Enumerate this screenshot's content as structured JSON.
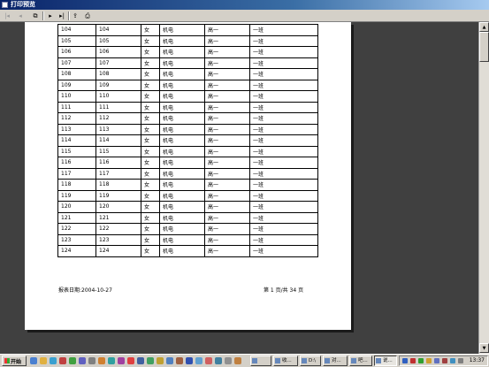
{
  "window": {
    "title": "打印预览"
  },
  "toolbar": {
    "buttons": [
      {
        "name": "first-page-icon",
        "glyph": "|◂"
      },
      {
        "name": "prev-page-icon",
        "glyph": "◂"
      },
      {
        "name": "copy-icon",
        "glyph": "⧉"
      },
      {
        "name": "next-page-icon",
        "glyph": "▸"
      },
      {
        "name": "last-page-icon",
        "glyph": "▸|"
      },
      {
        "name": "export-icon",
        "glyph": "⇪"
      },
      {
        "name": "print-icon",
        "glyph": "⎙"
      }
    ]
  },
  "report": {
    "rows": [
      [
        "104",
        "104",
        "女",
        "机电",
        "高一",
        "一班"
      ],
      [
        "105",
        "105",
        "女",
        "机电",
        "高一",
        "一班"
      ],
      [
        "106",
        "106",
        "女",
        "机电",
        "高一",
        "一班"
      ],
      [
        "107",
        "107",
        "女",
        "机电",
        "高一",
        "一班"
      ],
      [
        "108",
        "108",
        "女",
        "机电",
        "高一",
        "一班"
      ],
      [
        "109",
        "109",
        "女",
        "机电",
        "高一",
        "一班"
      ],
      [
        "110",
        "110",
        "女",
        "机电",
        "高一",
        "一班"
      ],
      [
        "111",
        "111",
        "女",
        "机电",
        "高一",
        "一班"
      ],
      [
        "112",
        "112",
        "女",
        "机电",
        "高一",
        "一班"
      ],
      [
        "113",
        "113",
        "女",
        "机电",
        "高一",
        "一班"
      ],
      [
        "114",
        "114",
        "女",
        "机电",
        "高一",
        "一班"
      ],
      [
        "115",
        "115",
        "女",
        "机电",
        "高一",
        "一班"
      ],
      [
        "116",
        "116",
        "女",
        "机电",
        "高一",
        "一班"
      ],
      [
        "117",
        "117",
        "女",
        "机电",
        "高一",
        "一班"
      ],
      [
        "118",
        "118",
        "女",
        "机电",
        "高一",
        "一班"
      ],
      [
        "119",
        "119",
        "女",
        "机电",
        "高一",
        "一班"
      ],
      [
        "120",
        "120",
        "女",
        "机电",
        "高一",
        "一班"
      ],
      [
        "121",
        "121",
        "女",
        "机电",
        "高一",
        "一班"
      ],
      [
        "122",
        "122",
        "女",
        "机电",
        "高一",
        "一班"
      ],
      [
        "123",
        "123",
        "女",
        "机电",
        "高一",
        "一班"
      ],
      [
        "124",
        "124",
        "女",
        "机电",
        "高一",
        "一班"
      ]
    ],
    "footer_date": "报表日期:2004-10-27",
    "footer_page": "第 1 页/共 34 页"
  },
  "taskbar": {
    "start_label": "开始",
    "tasks": [
      {
        "label": ""
      },
      {
        "label": "收..."
      },
      {
        "label": "D:\\"
      },
      {
        "label": "对..."
      },
      {
        "label": "吧..."
      },
      {
        "label": "说..."
      },
      {
        "label": "杨..."
      }
    ],
    "clock": "13:37"
  }
}
